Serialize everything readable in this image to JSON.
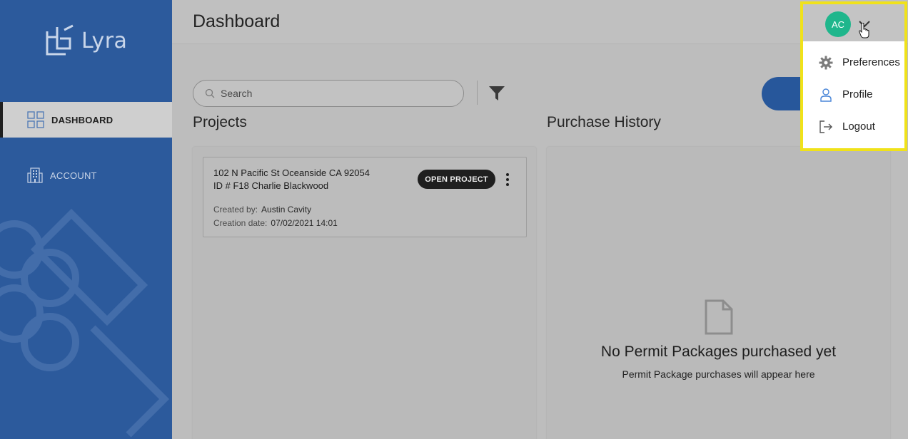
{
  "app": {
    "brand": "Lyra"
  },
  "sidebar": {
    "items": [
      {
        "label": "DASHBOARD",
        "icon": "grid-icon",
        "active": true
      },
      {
        "label": "ACCOUNT",
        "icon": "building-icon",
        "active": false
      }
    ]
  },
  "header": {
    "title": "Dashboard"
  },
  "search": {
    "placeholder": "Search"
  },
  "sections": {
    "projects": "Projects",
    "purchase_history": "Purchase History"
  },
  "project": {
    "address": "102 N Pacific St Oceanside CA 92054",
    "id_line": "ID # F18 Charlie Blackwood",
    "created_by_label": "Created by:",
    "created_by": "Austin Cavity",
    "creation_date_label": "Creation date:",
    "creation_date": "07/02/2021 14:01",
    "open_button": "OPEN PROJECT"
  },
  "purchase_history": {
    "empty_title": "No Permit Packages purchased yet",
    "empty_subtitle": "Permit Package purchases will appear here"
  },
  "user_menu": {
    "initials": "AC",
    "items": [
      {
        "label": "Preferences",
        "icon": "gear-icon"
      },
      {
        "label": "Profile",
        "icon": "person-icon"
      },
      {
        "label": "Logout",
        "icon": "logout-icon"
      }
    ]
  },
  "colors": {
    "sidebar": "#2c5a9c",
    "avatar": "#1fb68c",
    "highlight": "#f0e21a",
    "primary": "#27579b"
  }
}
